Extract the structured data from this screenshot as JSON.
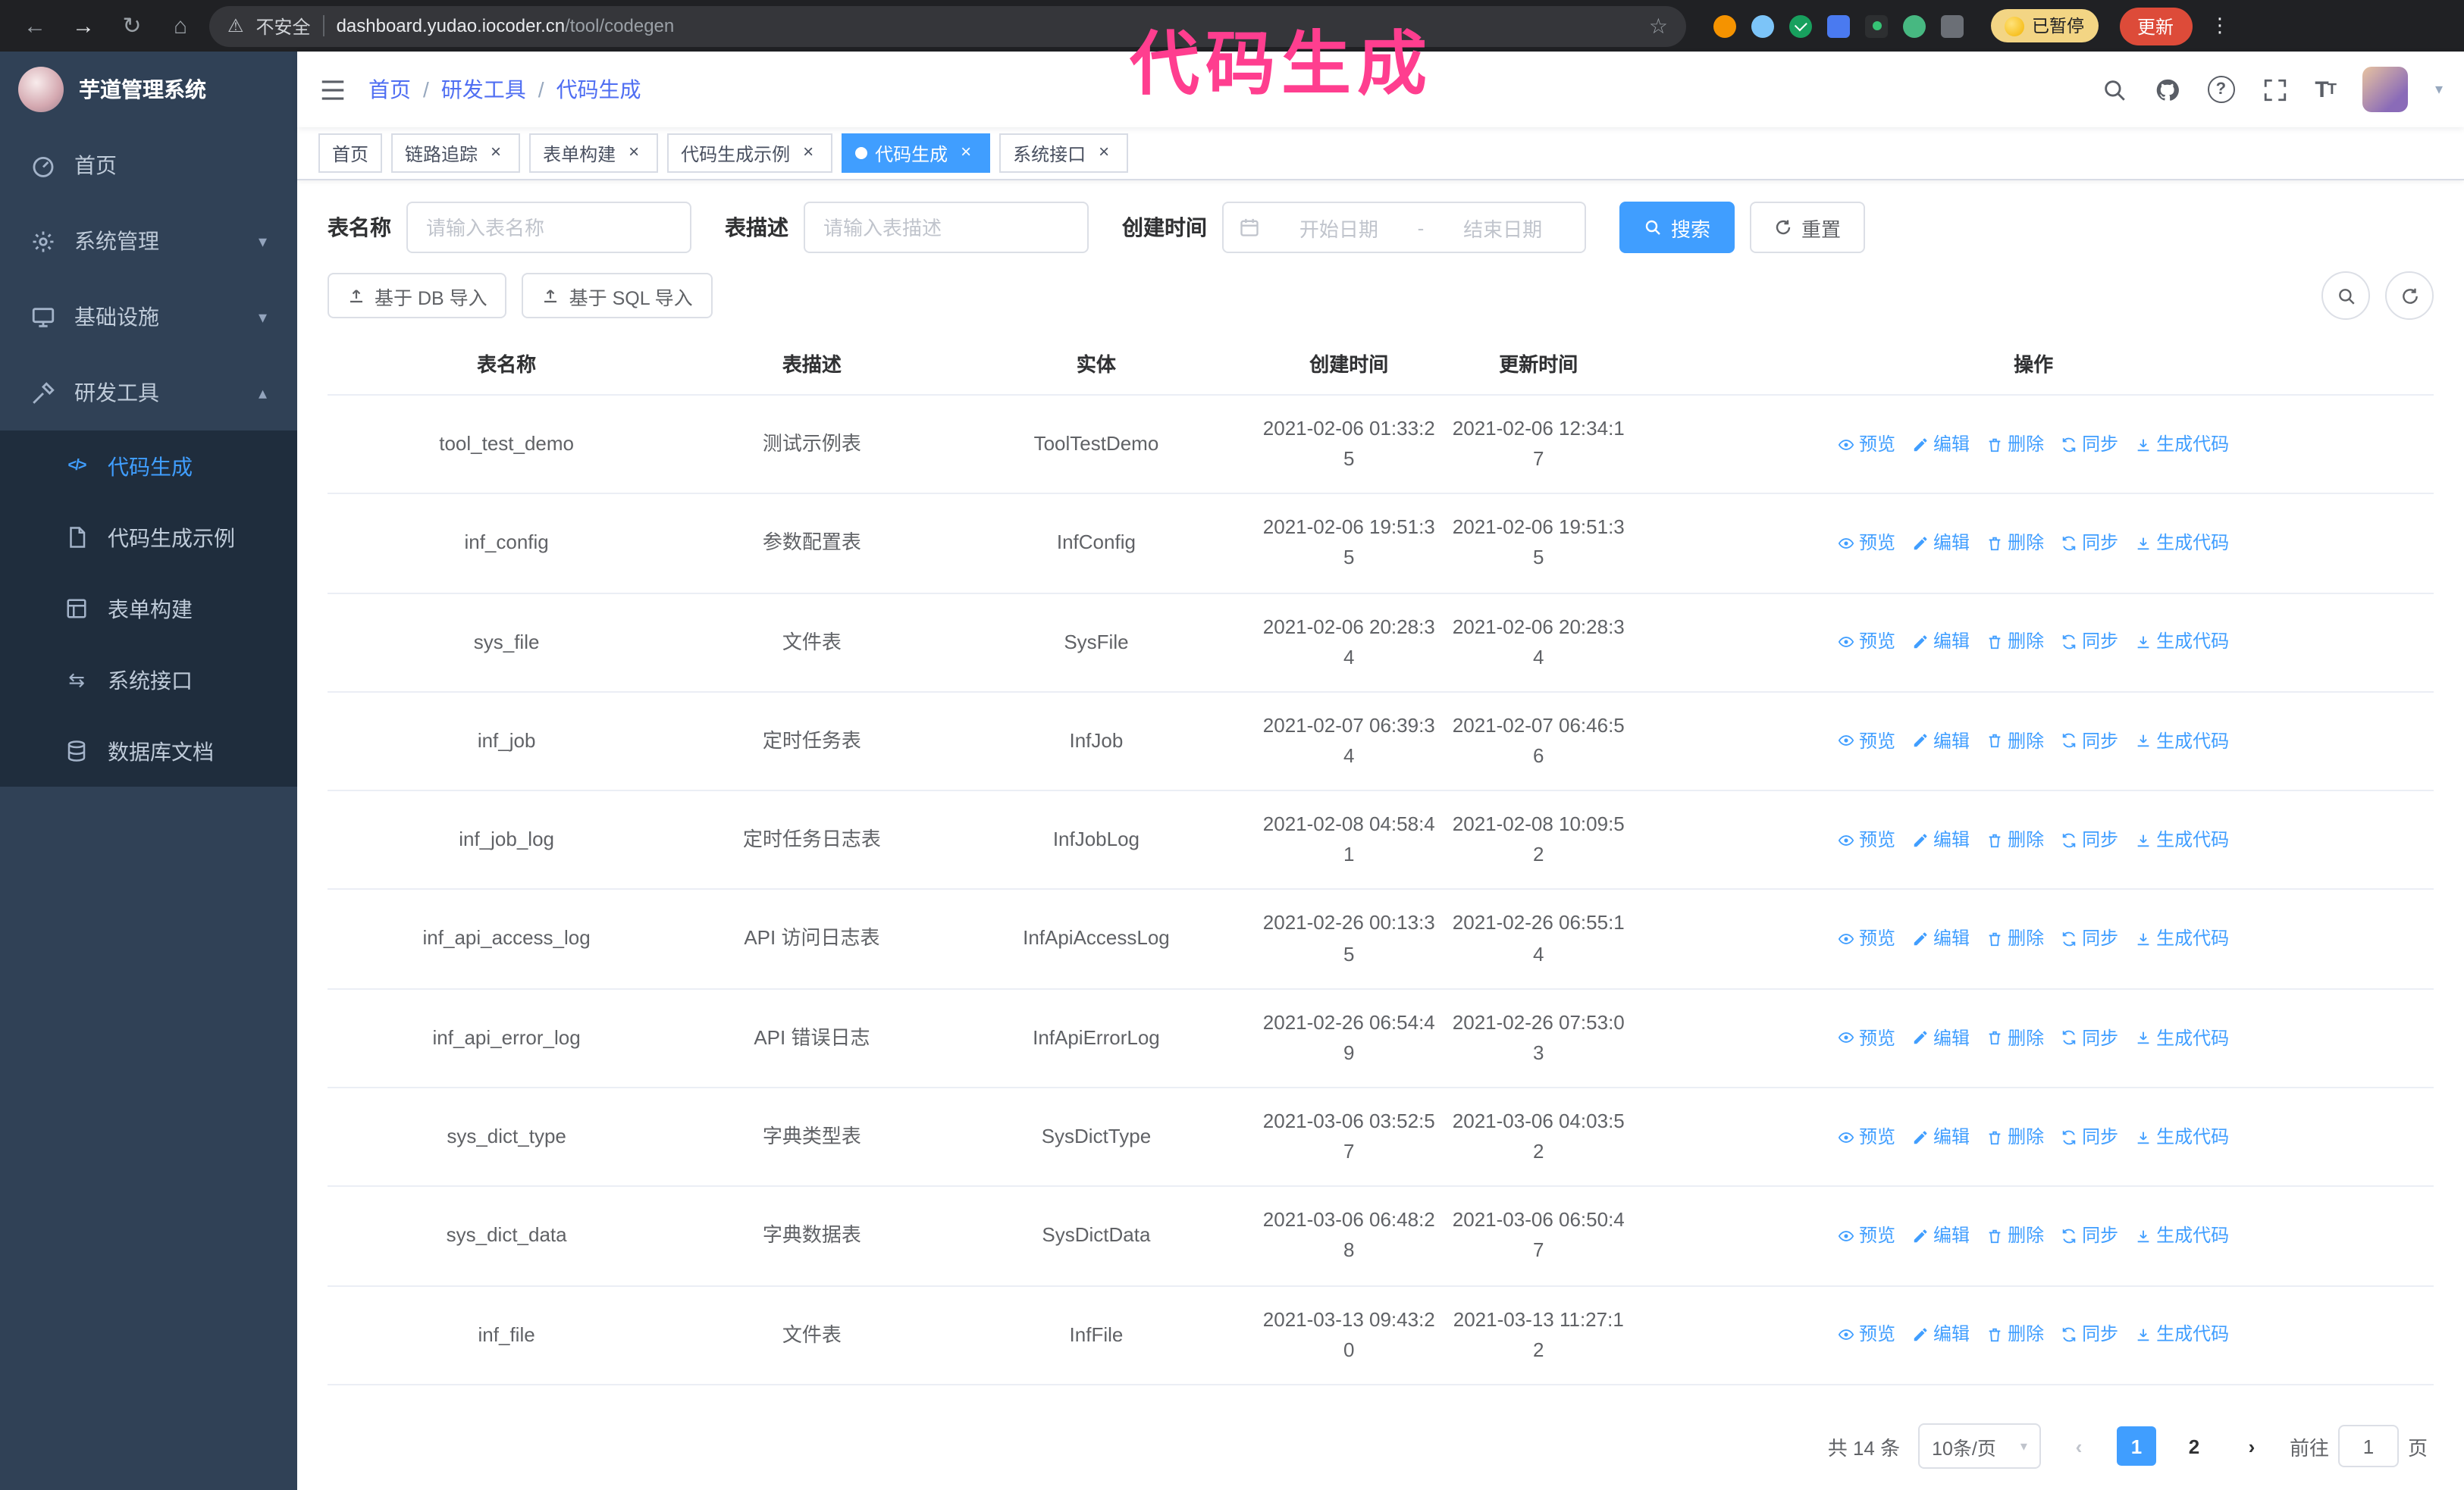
{
  "browser": {
    "security_label": "不安全",
    "url_host": "dashboard.yudao.iocoder.cn",
    "url_path": "/tool/codegen",
    "paused_badge": "已暂停",
    "update_button": "更新"
  },
  "annotation": {
    "text": "代码生成",
    "color": "#ff3e8f"
  },
  "app": {
    "title": "芋道管理系统"
  },
  "colors": {
    "accent": "#409eff",
    "sidebar_bg": "#304156",
    "submenu_bg": "#1f2d3d",
    "annotation_pink": "#ff3e8f",
    "update_red": "#dd4b39"
  },
  "icons": {
    "back": "←",
    "forward": "→",
    "reload": "↻",
    "home": "⌂",
    "warning": "⚠",
    "star": "☆",
    "kebab": "⋮",
    "close": "×",
    "caret_down": "▾",
    "chevron_down": "▾",
    "chevron_up": "▴",
    "prev": "‹",
    "next": "›",
    "api_glyph": "⇆",
    "code_glyph": "</>",
    "breadcrumb_sep": "/"
  },
  "sidebar": {
    "items": [
      {
        "label": "首页"
      },
      {
        "label": "系统管理",
        "expandable": true
      },
      {
        "label": "基础设施",
        "expandable": true
      },
      {
        "label": "研发工具",
        "expandable": true,
        "expanded": true
      }
    ],
    "sub_items": [
      {
        "label": "代码生成",
        "active": true
      },
      {
        "label": "代码生成示例"
      },
      {
        "label": "表单构建"
      },
      {
        "label": "系统接口"
      },
      {
        "label": "数据库文档"
      }
    ]
  },
  "breadcrumb": [
    "首页",
    "研发工具",
    "代码生成"
  ],
  "tags": [
    {
      "label": "首页",
      "closable": false
    },
    {
      "label": "链路追踪",
      "closable": true
    },
    {
      "label": "表单构建",
      "closable": true
    },
    {
      "label": "代码生成示例",
      "closable": true
    },
    {
      "label": "代码生成",
      "closable": true,
      "active": true
    },
    {
      "label": "系统接口",
      "closable": true
    }
  ],
  "filters": {
    "name_label": "表名称",
    "name_placeholder": "请输入表名称",
    "desc_label": "表描述",
    "desc_placeholder": "请输入表描述",
    "time_label": "创建时间",
    "start_placeholder": "开始日期",
    "end_placeholder": "结束日期",
    "range_separator": "-",
    "search_label": "搜索",
    "reset_label": "重置"
  },
  "toolbar": {
    "import_db": "基于 DB 导入",
    "import_sql": "基于 SQL 导入"
  },
  "table": {
    "headers": [
      "表名称",
      "表描述",
      "实体",
      "创建时间",
      "更新时间",
      "操作"
    ],
    "actions": [
      "预览",
      "编辑",
      "删除",
      "同步",
      "生成代码"
    ],
    "rows": [
      {
        "name": "tool_test_demo",
        "desc": "测试示例表",
        "entity": "ToolTestDemo",
        "created": "2021-02-06 01:33:25",
        "updated": "2021-02-06 12:34:17"
      },
      {
        "name": "inf_config",
        "desc": "参数配置表",
        "entity": "InfConfig",
        "created": "2021-02-06 19:51:35",
        "updated": "2021-02-06 19:51:35"
      },
      {
        "name": "sys_file",
        "desc": "文件表",
        "entity": "SysFile",
        "created": "2021-02-06 20:28:34",
        "updated": "2021-02-06 20:28:34"
      },
      {
        "name": "inf_job",
        "desc": "定时任务表",
        "entity": "InfJob",
        "created": "2021-02-07 06:39:34",
        "updated": "2021-02-07 06:46:56"
      },
      {
        "name": "inf_job_log",
        "desc": "定时任务日志表",
        "entity": "InfJobLog",
        "created": "2021-02-08 04:58:41",
        "updated": "2021-02-08 10:09:52"
      },
      {
        "name": "inf_api_access_log",
        "desc": "API 访问日志表",
        "entity": "InfApiAccessLog",
        "created": "2021-02-26 00:13:35",
        "updated": "2021-02-26 06:55:14"
      },
      {
        "name": "inf_api_error_log",
        "desc": "API 错误日志",
        "entity": "InfApiErrorLog",
        "created": "2021-02-26 06:54:49",
        "updated": "2021-02-26 07:53:03"
      },
      {
        "name": "sys_dict_type",
        "desc": "字典类型表",
        "entity": "SysDictType",
        "created": "2021-03-06 03:52:57",
        "updated": "2021-03-06 04:03:52"
      },
      {
        "name": "sys_dict_data",
        "desc": "字典数据表",
        "entity": "SysDictData",
        "created": "2021-03-06 06:48:28",
        "updated": "2021-03-06 06:50:47"
      },
      {
        "name": "inf_file",
        "desc": "文件表",
        "entity": "InfFile",
        "created": "2021-03-13 09:43:20",
        "updated": "2021-03-13 11:27:12"
      }
    ]
  },
  "pagination": {
    "total": "共 14 条",
    "page_size": "10条/页",
    "pages": [
      "1",
      "2"
    ],
    "current": "1",
    "goto_label": "前往",
    "goto_value": "1",
    "page_unit": "页"
  }
}
